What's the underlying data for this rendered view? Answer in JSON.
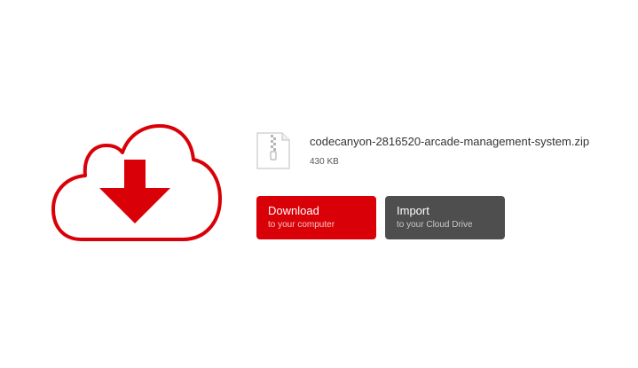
{
  "icons": {
    "cloud": "cloud-download-icon",
    "file": "zip-file-icon"
  },
  "colors": {
    "accent": "#d90007",
    "secondary": "#4e4e4e"
  },
  "file": {
    "name": "codecanyon-2816520-arcade-management-system.zip",
    "size": "430 KB"
  },
  "actions": {
    "download": {
      "title": "Download",
      "subtitle": "to your computer"
    },
    "import": {
      "title": "Import",
      "subtitle": "to your Cloud Drive"
    }
  }
}
